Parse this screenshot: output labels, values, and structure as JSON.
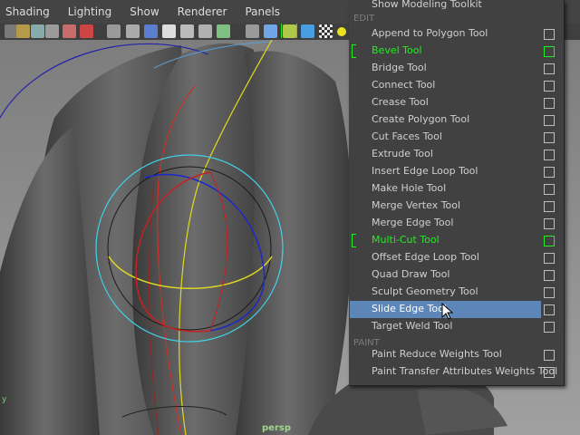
{
  "menubar": [
    "Shading",
    "Lighting",
    "Show",
    "Renderer",
    "Panels"
  ],
  "viewport": {
    "camera_label": "persp",
    "axis_label": "y"
  },
  "menu": {
    "top_item": "Show Modeling Toolkit",
    "sections": [
      {
        "title": "EDIT",
        "items": [
          {
            "label": "Append to Polygon Tool",
            "active": false
          },
          {
            "label": "Bevel Tool",
            "active": true
          },
          {
            "label": "Bridge Tool",
            "active": false
          },
          {
            "label": "Connect Tool",
            "active": false
          },
          {
            "label": "Crease Tool",
            "active": false
          },
          {
            "label": "Create Polygon Tool",
            "active": false
          },
          {
            "label": "Cut Faces Tool",
            "active": false
          },
          {
            "label": "Extrude Tool",
            "active": false
          },
          {
            "label": "Insert Edge Loop Tool",
            "active": false
          },
          {
            "label": "Make Hole Tool",
            "active": false
          },
          {
            "label": "Merge Vertex Tool",
            "active": false
          },
          {
            "label": "Merge Edge Tool",
            "active": false
          },
          {
            "label": "Multi-Cut Tool",
            "active": true
          },
          {
            "label": "Offset Edge Loop Tool",
            "active": false
          },
          {
            "label": "Quad Draw Tool",
            "active": false
          },
          {
            "label": "Sculpt Geometry Tool",
            "active": false
          },
          {
            "label": "Slide Edge Tool",
            "active": false,
            "highlighted": true
          },
          {
            "label": "Target Weld Tool",
            "active": false
          }
        ]
      },
      {
        "title": "PAINT",
        "items": [
          {
            "label": "Paint Reduce Weights Tool",
            "active": false
          },
          {
            "label": "Paint Transfer Attributes Weights Tool",
            "active": false
          }
        ]
      }
    ]
  },
  "colors": {
    "active": "#22ee22",
    "highlight": "#5b86b7",
    "menu_bg": "#414141"
  },
  "icons": [
    "select-tool-icon",
    "lasso-icon",
    "paint-select-icon",
    "move-icon",
    "rotate-icon",
    "scale-icon",
    "wireframe-icon",
    "smooth-shade-icon",
    "textured-icon",
    "lighting-icon",
    "shadow-icon",
    "isolate-icon",
    "xray-icon",
    "cube-icon",
    "checker-icon",
    "light-icon"
  ]
}
